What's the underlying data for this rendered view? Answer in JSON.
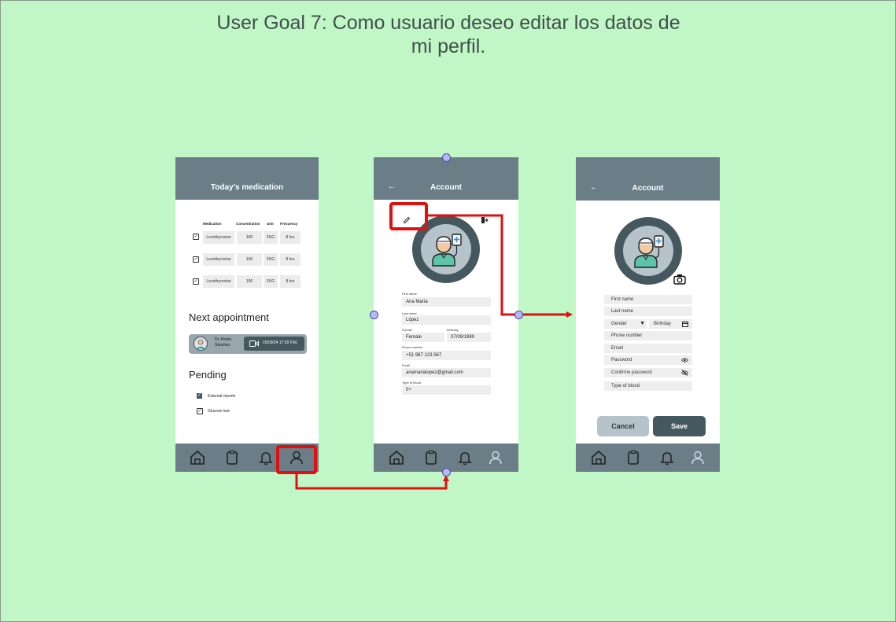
{
  "title": "User Goal 7: Como usuario deseo editar los datos de mi perfil.",
  "colors": {
    "background": "#c1f6c7",
    "header": "#6b7e88",
    "highlight": "#e01010"
  },
  "screen1": {
    "header_title": "Today's medication",
    "table_headers": [
      "Medication",
      "Concentration",
      "Unit",
      "Frecuency"
    ],
    "rows": [
      [
        "Levothyroxine",
        "100",
        "FKG",
        "8 hrs"
      ],
      [
        "Levothyroxine",
        "100",
        "FKG",
        "8 hrs"
      ],
      [
        "Levothyroxine",
        "100",
        "FKG",
        "8 hrs"
      ]
    ],
    "next_appointment_title": "Next appointment",
    "doctor_name": "Dr. Pedro Sánchez",
    "appointment_time": "15/09/24 17:30 P.M.",
    "pending_title": "Pending",
    "pending_items": [
      "External reports",
      "Glucose test"
    ],
    "nav_icons": [
      "home-icon",
      "clipboard-icon",
      "bell-icon",
      "user-icon"
    ]
  },
  "screen2": {
    "header_title": "Account",
    "first_name_label": "First name",
    "first_name": "Ana María",
    "last_name_label": "Last name",
    "last_name": "López",
    "gender_label": "Gender",
    "gender": "Female",
    "birthday_label": "Birthday",
    "birthday": "07/09/1980",
    "phone_label": "Phone number",
    "phone": "+51 987 123 567",
    "email_label": "Email",
    "email": "anamarialopez@gmail.com",
    "blood_label": "Type of blood",
    "blood": "0+"
  },
  "screen3": {
    "header_title": "Account",
    "first_name_ph": "First name",
    "last_name_ph": "Last name",
    "gender_ph": "Gender",
    "birthday_ph": "Birthday",
    "phone_ph": "Phone number",
    "email_ph": "Email",
    "password_ph": "Password",
    "confirm_password_ph": "Confirme password",
    "blood_ph": "Type of blood",
    "cancel_label": "Cancel",
    "save_label": "Save"
  }
}
